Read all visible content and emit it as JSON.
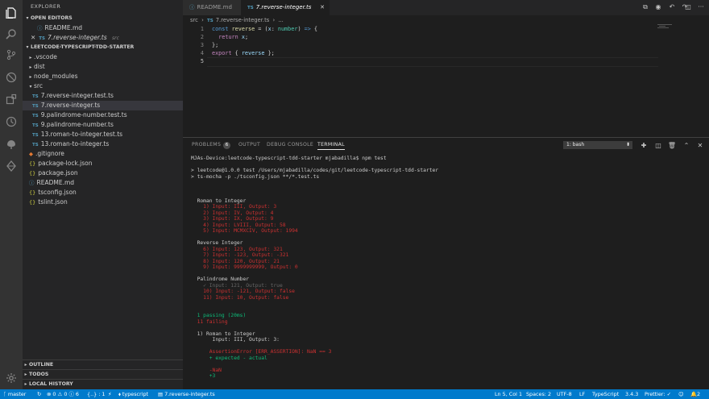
{
  "sidebar": {
    "title": "EXPLORER",
    "open_editors_label": "OPEN EDITORS",
    "open_editors": [
      {
        "name": "README.md",
        "icon": "markdown-icon"
      },
      {
        "name": "7.reverse-integer.ts",
        "path": "src",
        "icon": "typescript-icon"
      }
    ],
    "folder_label": "LEETCODE-TYPESCRIPT-TDD-STARTER",
    "tree": [
      {
        "name": ".vscode",
        "type": "folder"
      },
      {
        "name": "dist",
        "type": "folder"
      },
      {
        "name": "node_modules",
        "type": "folder"
      },
      {
        "name": "src",
        "type": "folder-open"
      },
      {
        "name": "7.reverse-integer.test.ts",
        "type": "ts"
      },
      {
        "name": "7.reverse-integer.ts",
        "type": "ts"
      },
      {
        "name": "9.palindrome-number.test.ts",
        "type": "ts"
      },
      {
        "name": "9.palindrome-number.ts",
        "type": "ts"
      },
      {
        "name": "13.roman-to-integer.test.ts",
        "type": "ts"
      },
      {
        "name": "13.roman-to-integer.ts",
        "type": "ts"
      },
      {
        "name": ".gitignore",
        "type": "git"
      },
      {
        "name": "package-lock.json",
        "type": "json"
      },
      {
        "name": "package.json",
        "type": "json"
      },
      {
        "name": "README.md",
        "type": "md"
      },
      {
        "name": "tsconfig.json",
        "type": "json"
      },
      {
        "name": "tslint.json",
        "type": "json"
      }
    ],
    "outline_label": "OUTLINE",
    "todos_label": "TODOS",
    "local_history_label": "LOCAL HISTORY"
  },
  "tabs": [
    {
      "label": "README.md",
      "icon": "markdown-icon",
      "active": false
    },
    {
      "label": "7.reverse-integer.ts",
      "icon": "typescript-icon",
      "active": true
    }
  ],
  "breadcrumb": {
    "folder": "src",
    "file": "7.reverse-integer.ts",
    "more": "..."
  },
  "editor": {
    "line_numbers": [
      "1",
      "2",
      "3",
      "4",
      "5"
    ],
    "current_line": "5"
  },
  "panel": {
    "tabs": [
      "PROBLEMS",
      "OUTPUT",
      "DEBUG CONSOLE",
      "TERMINAL"
    ],
    "problems_count": "6",
    "active_tab": "TERMINAL",
    "terminal_select": "1: bash",
    "terminal_lines": [
      {
        "t": "MJAs-Device:leetcode-typescript-tdd-starter mjabadilla$ npm test",
        "c": ""
      },
      {
        "t": "",
        "c": ""
      },
      {
        "t": "> leetcode@1.0.0 test /Users/mjabadilla/codes/git/leetcode-typescript-tdd-starter",
        "c": ""
      },
      {
        "t": "> ts-mocha -p ./tsconfig.json **/*.test.ts",
        "c": ""
      },
      {
        "t": "",
        "c": ""
      },
      {
        "t": "",
        "c": ""
      },
      {
        "t": "",
        "c": ""
      },
      {
        "t": "  Roman to Integer",
        "c": ""
      },
      {
        "t": "    1) Input: III, Output: 3",
        "c": "red"
      },
      {
        "t": "    2) Input: IV, Output: 4",
        "c": "red"
      },
      {
        "t": "    3) Input: IX, Output: 9",
        "c": "red"
      },
      {
        "t": "    4) Input: LVIII, Output: 58",
        "c": "red"
      },
      {
        "t": "    5) Input: MCMXCIV, Output: 1994",
        "c": "red"
      },
      {
        "t": "",
        "c": ""
      },
      {
        "t": "  Reverse Integer",
        "c": ""
      },
      {
        "t": "    6) Input: 123, Output: 321",
        "c": "red"
      },
      {
        "t": "    7) Input: -123, Output: -321",
        "c": "red"
      },
      {
        "t": "    8) Input: 120, Output: 21",
        "c": "red"
      },
      {
        "t": "    9) Input: 9999999999, Output: 0",
        "c": "red"
      },
      {
        "t": "",
        "c": ""
      },
      {
        "t": "  Palindrome Number",
        "c": ""
      },
      {
        "t": "    ✓ Input: 121, Output: true",
        "c": "gray"
      },
      {
        "t": "    10) Input: -121, Output: false",
        "c": "red"
      },
      {
        "t": "    11) Input: 10, Output: false",
        "c": "red"
      },
      {
        "t": "",
        "c": ""
      },
      {
        "t": "",
        "c": ""
      },
      {
        "t": "  1 passing (20ms)",
        "c": "green"
      },
      {
        "t": "  11 failing",
        "c": "red"
      },
      {
        "t": "",
        "c": ""
      },
      {
        "t": "  1) Roman to Integer",
        "c": ""
      },
      {
        "t": "       Input: III, Output: 3:",
        "c": ""
      },
      {
        "t": "",
        "c": ""
      },
      {
        "t": "      AssertionError [ERR_ASSERTION]: NaN == 3",
        "c": "red"
      },
      {
        "t": "      + expected - actual",
        "c": "green"
      },
      {
        "t": "",
        "c": ""
      },
      {
        "t": "      -NaN",
        "c": "red"
      },
      {
        "t": "      +3",
        "c": "green"
      }
    ]
  },
  "status": {
    "branch": "master",
    "errors": "0",
    "warnings": "0",
    "info": "6",
    "selection": "{..} : 1",
    "language_badge": "typescript",
    "file": "7.reverse-integer.ts",
    "position": "Ln 5, Col 1",
    "spaces": "Spaces: 2",
    "encoding": "UTF-8",
    "eol": "LF",
    "language": "TypeScript",
    "ts_version": "3.4.3",
    "prettier": "Prettier: ✓",
    "notifications": "2"
  },
  "colors": {
    "activity_bar": "#333333",
    "sidebar": "#252526",
    "editor": "#1e1e1e",
    "status_bar": "#007acc",
    "terminal_red": "#cd3131",
    "terminal_green": "#0dbc79"
  }
}
